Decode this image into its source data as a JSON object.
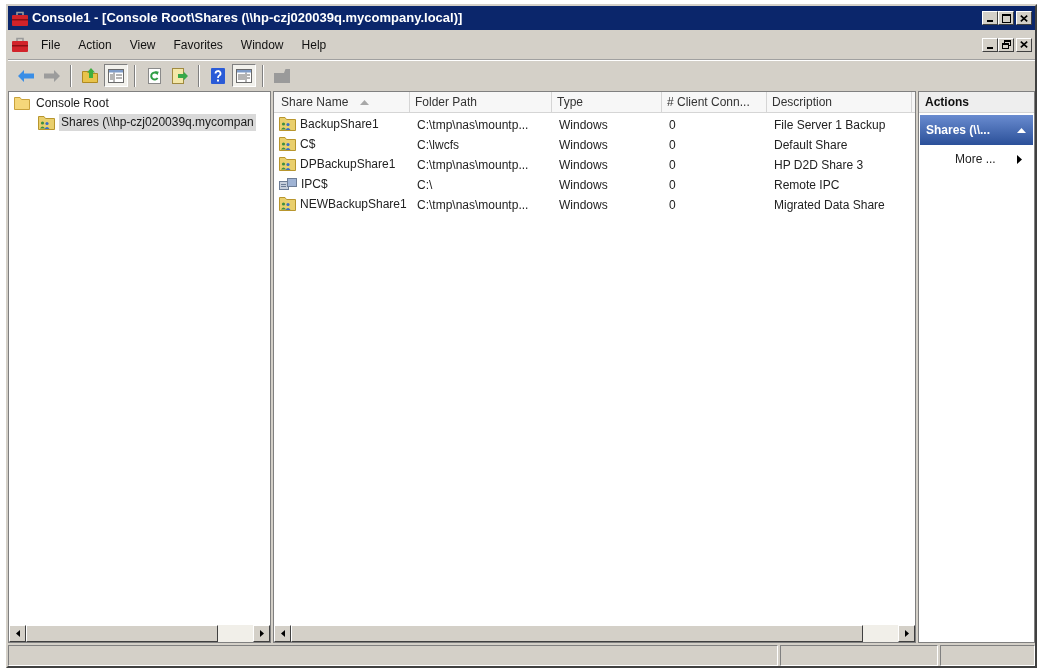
{
  "window": {
    "title": "Console1 - [Console Root\\Shares (\\\\hp-czj020039q.mycompany.local)]"
  },
  "menu": [
    "File",
    "Action",
    "View",
    "Favorites",
    "Window",
    "Help"
  ],
  "toolbar": [
    {
      "kind": "back",
      "disabled": false,
      "pressed": false
    },
    {
      "kind": "forward",
      "disabled": true,
      "pressed": false
    },
    {
      "kind": "separator"
    },
    {
      "kind": "up",
      "disabled": false,
      "pressed": false
    },
    {
      "kind": "tree_toggle",
      "disabled": false,
      "pressed": true
    },
    {
      "kind": "separator"
    },
    {
      "kind": "refresh",
      "disabled": false,
      "pressed": false
    },
    {
      "kind": "export",
      "disabled": false,
      "pressed": false
    },
    {
      "kind": "separator"
    },
    {
      "kind": "help",
      "disabled": false,
      "pressed": false
    },
    {
      "kind": "pane_toggle",
      "disabled": false,
      "pressed": true
    },
    {
      "kind": "separator"
    },
    {
      "kind": "properties",
      "disabled": true,
      "pressed": false
    }
  ],
  "tree": [
    {
      "label": "Console Root",
      "kind": "folder",
      "selected": false,
      "children": [
        {
          "label": "Shares (\\\\hp-czj020039q.mycompan",
          "kind": "shares",
          "selected": true
        }
      ]
    }
  ],
  "table": {
    "columns": [
      {
        "label": "Share Name",
        "sorted": true
      },
      {
        "label": "Folder Path",
        "sorted": false
      },
      {
        "label": "Type",
        "sorted": false
      },
      {
        "label": "# Client Conn...",
        "sorted": false
      },
      {
        "label": "Description",
        "sorted": false
      }
    ],
    "rows": [
      {
        "kind": "share",
        "selected": false,
        "cells": [
          "BackupShare1",
          "C:\\tmp\\nas\\mountp...",
          "Windows",
          "0",
          "File Server 1 Backup"
        ]
      },
      {
        "kind": "share",
        "selected": false,
        "cells": [
          "C$",
          "C:\\lwcfs",
          "Windows",
          "0",
          "Default Share"
        ]
      },
      {
        "kind": "share",
        "selected": false,
        "cells": [
          "DPBackupShare1",
          "C:\\tmp\\nas\\mountp...",
          "Windows",
          "0",
          "HP D2D Share 3"
        ]
      },
      {
        "kind": "ipc",
        "selected": false,
        "cells": [
          "IPC$",
          "C:\\",
          "Windows",
          "0",
          "Remote IPC"
        ]
      },
      {
        "kind": "share",
        "selected": false,
        "cells": [
          "NEWBackupShare1",
          "C:\\tmp\\nas\\mountp...",
          "Windows",
          "0",
          "Migrated Data Share"
        ]
      }
    ]
  },
  "actions": {
    "title": "Actions",
    "sections": [
      {
        "title": "Shares (\\\\...",
        "expanded": true,
        "items": [
          {
            "label": "More ...",
            "kind": "submenu"
          }
        ]
      }
    ]
  }
}
